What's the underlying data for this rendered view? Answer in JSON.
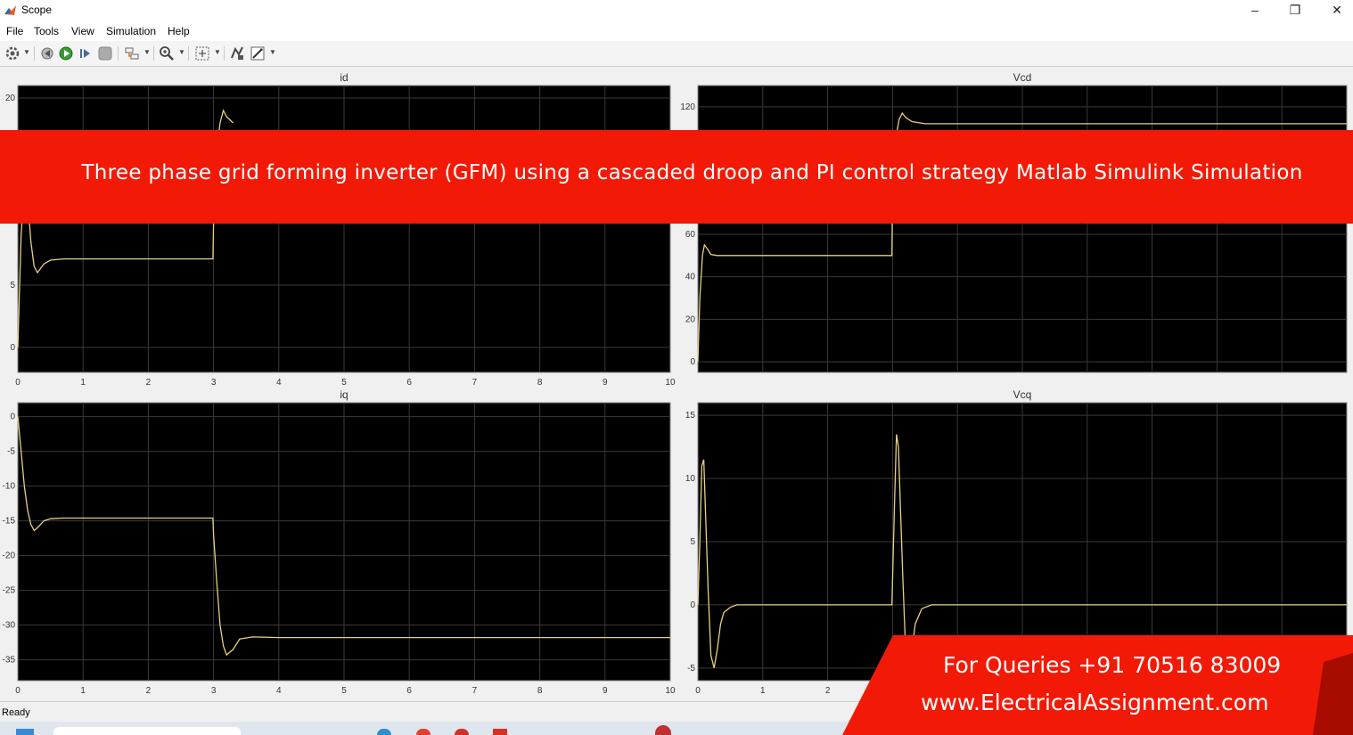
{
  "window": {
    "title": "Scope"
  },
  "menu": [
    "File",
    "Tools",
    "View",
    "Simulation",
    "Help"
  ],
  "status": "Ready",
  "banner": {
    "text": "Three phase grid forming inverter (GFM) using a cascaded droop and PI control strategy Matlab Simulink Simulation"
  },
  "contact": {
    "line1": "For Queries +91 70516 83009",
    "line2": "www.ElectricalAssignment.com"
  },
  "colors": {
    "plot_bg": "#000000",
    "grid": "#3a3a3a",
    "trace": "#e8d080",
    "banner": "#f21a06"
  },
  "chart_data": [
    {
      "type": "line",
      "title": "id",
      "xlim": [
        0,
        10
      ],
      "ylim": [
        -2,
        21
      ],
      "yticks": [
        0,
        5,
        20
      ],
      "xticks": [
        "0",
        "1",
        "2",
        "3",
        "4",
        "5",
        "6",
        "7",
        "8",
        "9",
        "10"
      ],
      "grid": true,
      "series": [
        {
          "x": [
            0,
            0.05,
            0.1,
            0.15,
            0.2,
            0.25,
            0.3,
            0.4,
            0.5,
            0.7,
            1,
            2,
            2.99,
            3.0,
            3.05,
            3.1,
            3.15,
            3.2,
            3.3
          ],
          "y": [
            0,
            9,
            13,
            12,
            8.5,
            6.5,
            6,
            6.7,
            7,
            7.1,
            7.1,
            7.1,
            7.1,
            10,
            16,
            18,
            19,
            18.5,
            18
          ]
        }
      ]
    },
    {
      "type": "line",
      "title": "Vcd",
      "xlim": [
        0,
        10
      ],
      "ylim": [
        -5,
        130
      ],
      "yticks": [
        0,
        20,
        40,
        60,
        120
      ],
      "xticks": [],
      "grid": true,
      "series": [
        {
          "x": [
            0,
            0.03,
            0.07,
            0.1,
            0.15,
            0.2,
            0.3,
            0.5,
            1,
            2,
            2.99,
            3.0,
            3.05,
            3.1,
            3.15,
            3.2,
            3.3,
            3.5,
            4,
            6,
            8,
            10
          ],
          "y": [
            0,
            30,
            50,
            55,
            53,
            50.5,
            50,
            50,
            50,
            50,
            50,
            80,
            105,
            114,
            117,
            115,
            113,
            112,
            112,
            112,
            112,
            112
          ]
        }
      ]
    },
    {
      "type": "line",
      "title": "iq",
      "xlim": [
        0,
        10
      ],
      "ylim": [
        -38,
        2
      ],
      "yticks": [
        0,
        -5,
        -10,
        -15,
        -20,
        -25,
        -30,
        -35
      ],
      "xticks": [
        "0",
        "1",
        "2",
        "3",
        "4",
        "5",
        "6",
        "7",
        "8",
        "9",
        "10"
      ],
      "grid": true,
      "series": [
        {
          "x": [
            0,
            0.05,
            0.1,
            0.15,
            0.2,
            0.25,
            0.3,
            0.4,
            0.5,
            0.7,
            1,
            2,
            2.99,
            3.0,
            3.05,
            3.1,
            3.15,
            3.2,
            3.3,
            3.4,
            3.6,
            4,
            6,
            8,
            10
          ],
          "y": [
            0,
            -5,
            -10,
            -13.5,
            -15.5,
            -16.4,
            -16,
            -15,
            -14.7,
            -14.6,
            -14.6,
            -14.6,
            -14.6,
            -17,
            -24,
            -30,
            -33,
            -34.3,
            -33.5,
            -32,
            -31.7,
            -31.8,
            -31.8,
            -31.8,
            -31.8
          ]
        }
      ]
    },
    {
      "type": "line",
      "title": "Vcq",
      "xlim": [
        0,
        10
      ],
      "ylim": [
        -6,
        16
      ],
      "yticks": [
        15,
        10,
        5,
        0,
        -5
      ],
      "xticks": [
        "0",
        "1",
        "2"
      ],
      "grid": true,
      "series": [
        {
          "x": [
            0,
            0.03,
            0.06,
            0.09,
            0.12,
            0.16,
            0.2,
            0.25,
            0.3,
            0.35,
            0.4,
            0.5,
            0.6,
            0.8,
            1,
            2,
            2.99,
            3.0,
            3.03,
            3.06,
            3.09,
            3.12,
            3.16,
            3.2,
            3.25,
            3.3,
            3.35,
            3.45,
            3.6,
            3.8,
            4,
            6,
            8,
            10
          ],
          "y": [
            0,
            5,
            11,
            11.5,
            7,
            1,
            -4,
            -5,
            -3.5,
            -1.5,
            -0.6,
            -0.2,
            0,
            0,
            0,
            0,
            0,
            2,
            8,
            13.5,
            12.5,
            8,
            2,
            -3.5,
            -5,
            -3.5,
            -1.5,
            -0.3,
            0,
            0,
            0,
            0,
            0,
            0
          ]
        }
      ]
    }
  ]
}
